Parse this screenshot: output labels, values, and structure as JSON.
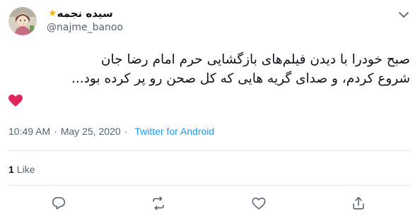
{
  "user": {
    "display_name": "سیده نجمه",
    "handle": "@najme_banoo"
  },
  "tweet": {
    "line1": "صبح خودرا با دیدن فیلم‌های بازگشایی حرم امام رضا جان",
    "line2": "شروع کردم، و صدای گریه هایی که کل صحن رو پر کرده بود..."
  },
  "meta": {
    "time": "10:49 AM",
    "separator": "·",
    "date": "May 25, 2020",
    "source": "Twitter for Android"
  },
  "likes": {
    "count": "1",
    "label": "Like"
  },
  "icons": {
    "menu": "chevron-down-icon",
    "reply": "reply-icon",
    "retweet": "retweet-icon",
    "like": "heart-outline-icon",
    "share": "share-icon",
    "emoji": "red-heart-icon"
  },
  "colors": {
    "link": "#1d9bf0",
    "secondary_text": "#536471",
    "heart": "#e0245e",
    "star": "#f4b400"
  }
}
